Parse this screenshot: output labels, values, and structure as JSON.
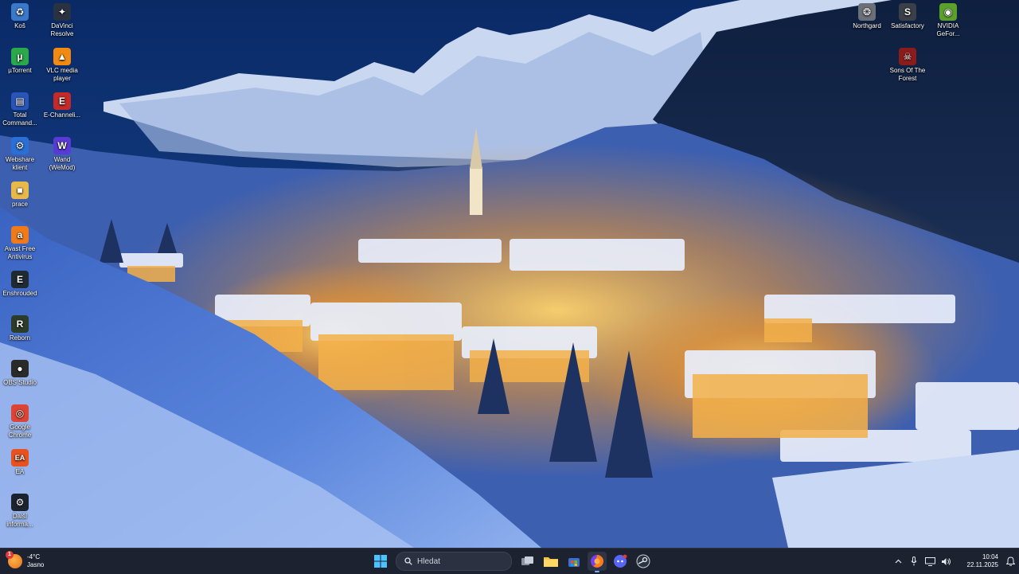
{
  "desktop_icons": {
    "col1": [
      {
        "label": "Koš",
        "icon": "recycle-bin-icon",
        "color": "#3a78c9"
      },
      {
        "label": "µTorrent",
        "icon": "utorrent-icon",
        "color": "#2aa84a"
      },
      {
        "label": "Total Command...",
        "icon": "total-commander-icon",
        "color": "#2855b8"
      },
      {
        "label": "Webshare klient",
        "icon": "webshare-icon",
        "color": "#2a6fd6"
      },
      {
        "label": "prace",
        "icon": "folder-icon",
        "color": "#e8b84a"
      },
      {
        "label": "Avast Free Antivirus",
        "icon": "avast-icon",
        "color": "#f07a1a"
      },
      {
        "label": "Enshrouded",
        "icon": "enshrouded-icon",
        "color": "#1f2a33"
      },
      {
        "label": "Reborn",
        "icon": "reborn-icon",
        "color": "#2c3c2a"
      },
      {
        "label": "OBS Studio",
        "icon": "obs-icon",
        "color": "#2a2a2a"
      },
      {
        "label": "Google Chrome",
        "icon": "chrome-icon",
        "color": "#dd4433"
      },
      {
        "label": "EA",
        "icon": "ea-icon",
        "color": "#e8521f"
      },
      {
        "label": "Další informa...",
        "icon": "info-icon",
        "color": "#1c2230"
      }
    ],
    "col2": [
      {
        "label": "DaVinci Resolve",
        "icon": "davinci-resolve-icon",
        "color": "#2a3140"
      },
      {
        "label": "VLC media player",
        "icon": "vlc-icon",
        "color": "#f08a12"
      },
      {
        "label": "E-Channeli...",
        "icon": "e-channelizer-icon",
        "color": "#c42a2a"
      },
      {
        "label": "Wand (WeMod)",
        "icon": "wand-icon",
        "color": "#5a3ad6"
      }
    ],
    "right": [
      {
        "label": "Northgard",
        "icon": "northgard-icon",
        "color": "#6a6f78"
      },
      {
        "label": "Satisfactory",
        "icon": "satisfactory-icon",
        "color": "#3a3f48"
      },
      {
        "label": "NVIDIA GeFor...",
        "icon": "nvidia-icon",
        "color": "#5aa02a"
      },
      {
        "label": "Sons Of The Forest",
        "icon": "sons-of-the-forest-icon",
        "color": "#8a1c1c"
      }
    ]
  },
  "taskbar": {
    "weather": {
      "temp": "-4°C",
      "condition": "Jasno",
      "badge": "1"
    },
    "search_placeholder": "Hledat",
    "apps": [
      {
        "name": "task-view-button",
        "icon": "task-view-icon"
      },
      {
        "name": "file-explorer-button",
        "icon": "folder-icon"
      },
      {
        "name": "microsoft-store-button",
        "icon": "store-icon"
      },
      {
        "name": "firefox-button",
        "icon": "firefox-icon",
        "active": true
      },
      {
        "name": "discord-button",
        "icon": "discord-icon"
      },
      {
        "name": "steam-button",
        "icon": "steam-icon"
      }
    ],
    "tray": {
      "chevron": "^",
      "time": "10:04",
      "date": "22.11.2025"
    }
  },
  "colors": {
    "taskbar_bg": "#1c2230",
    "accent": "#7aa7ff"
  }
}
